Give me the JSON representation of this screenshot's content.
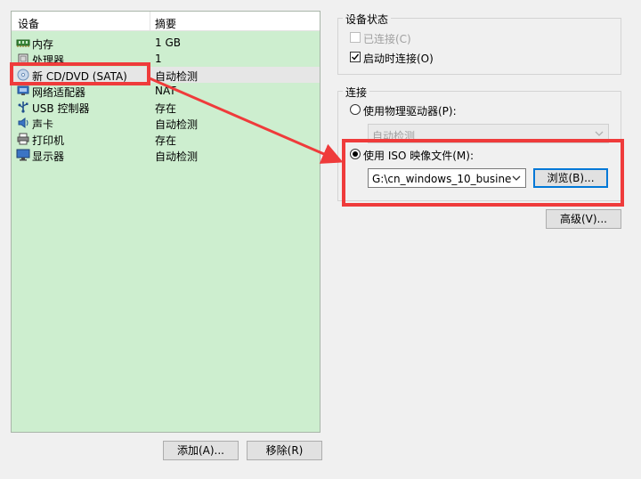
{
  "device_list": {
    "col_device": "设备",
    "col_summary": "摘要",
    "devices": [
      {
        "name": "内存",
        "summary": "1 GB"
      },
      {
        "name": "处理器",
        "summary": "1"
      },
      {
        "name": "新 CD/DVD (SATA)",
        "summary": "自动检测"
      },
      {
        "name": "网络适配器",
        "summary": "NAT"
      },
      {
        "name": "USB 控制器",
        "summary": "存在"
      },
      {
        "name": "声卡",
        "summary": "自动检测"
      },
      {
        "name": "打印机",
        "summary": "存在"
      },
      {
        "name": "显示器",
        "summary": "自动检测"
      }
    ],
    "selected_index": 2
  },
  "buttons": {
    "add": "添加(A)...",
    "remove": "移除(R)"
  },
  "device_status": {
    "title": "设备状态",
    "connected_label": "已连接(C)",
    "connected_checked": false,
    "connected_enabled": false,
    "connect_at_power_on_label": "启动时连接(O)",
    "connect_at_power_on_checked": true
  },
  "connection": {
    "title": "连接",
    "physical_drive_label": "使用物理驱动器(P):",
    "physical_drive_value": "自动检测",
    "iso_label": "使用 ISO 映像文件(M):",
    "iso_path": "G:\\cn_windows_10_busines",
    "browse_label": "浏览(B)...",
    "selected": "iso"
  },
  "advanced_label": "高级(V)...",
  "icons": [
    "memory-icon",
    "processor-icon",
    "cd-dvd-icon",
    "network-adapter-icon",
    "usb-icon",
    "sound-card-icon",
    "printer-icon",
    "display-icon",
    "checkmark-icon",
    "chevron-down-icon"
  ],
  "colors": {
    "list_bg": "#cdeecf",
    "annotation_red": "#ef3b3b",
    "focus_blue": "#0078d7"
  }
}
